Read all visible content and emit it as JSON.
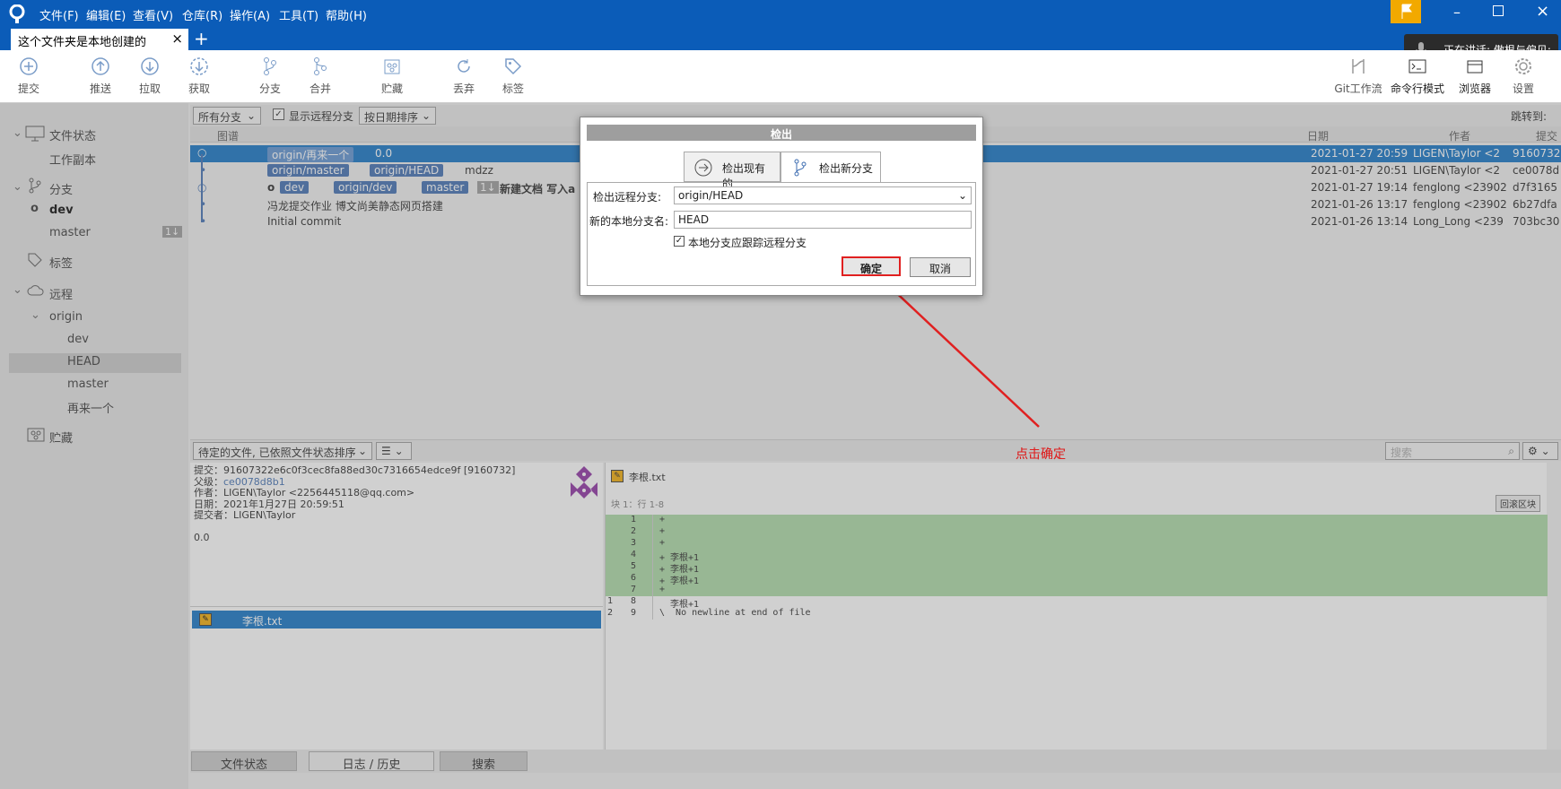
{
  "app": {
    "menus": [
      "文件(F)",
      "编辑(E)",
      "查看(V)",
      "仓库(R)",
      "操作(A)",
      "工具(T)",
      "帮助(H)"
    ],
    "tab_title": "这个文件夹是本地创建的",
    "speaking": "正在讲话: 傲根与偏见;"
  },
  "toolbar": {
    "left": [
      "提交",
      "推送",
      "拉取",
      "获取",
      "分支",
      "合并",
      "贮藏",
      "丢弃",
      "标签"
    ],
    "right": [
      "Git工作流",
      "命令行模式",
      "浏览器",
      "设置"
    ]
  },
  "sidebar": {
    "file_status": "文件状态",
    "working_copy": "工作副本",
    "branches": "分支",
    "branch_items": [
      "dev",
      "master"
    ],
    "master_badge": "1↓",
    "tags": "标签",
    "remotes": "远程",
    "origin": "origin",
    "remote_items": [
      "dev",
      "HEAD",
      "master",
      "再来一个"
    ],
    "stashes": "贮藏"
  },
  "filter": {
    "branch_select": "所有分支",
    "show_remote": "显示远程分支",
    "sort": "按日期排序",
    "jump": "跳转到:"
  },
  "columns": {
    "graph": "图谱",
    "date": "日期",
    "author": "作者",
    "commit": "提交"
  },
  "commits": [
    {
      "tags": [
        "origin/再来一个"
      ],
      "msg": "0.0",
      "date": "2021-01-27 20:59",
      "author": "LIGEN\\Taylor <2",
      "hash": "9160732"
    },
    {
      "tags": [
        "origin/master",
        "origin/HEAD"
      ],
      "msg": "mdzz",
      "date": "2021-01-27 20:51",
      "author": "LIGEN\\Taylor <2",
      "hash": "ce0078d"
    },
    {
      "tags": [
        "dev",
        "origin/dev",
        "master"
      ],
      "badge": "1↓",
      "msg": "新建文档  写入a",
      "date": "2021-01-27 19:14",
      "author": "fenglong <23902",
      "hash": "d7f3165"
    },
    {
      "tags": [],
      "msg": "冯龙提交作业  博文尚美静态网页搭建",
      "date": "2021-01-26 13:17",
      "author": "fenglong <23902",
      "hash": "6b27dfa"
    },
    {
      "tags": [],
      "msg": "Initial commit",
      "date": "2021-01-26 13:14",
      "author": "Long_Long <239",
      "hash": "703bc30"
    }
  ],
  "lower": {
    "sort_select": "待定的文件, 已依照文件状态排序",
    "search_placeholder": "搜索",
    "annotation": "点击确定"
  },
  "details": {
    "commit": "提交：91607322e6c0f3cec8fa88ed30c7316654edce9f [9160732]",
    "parent_label": "父级：",
    "parent": "ce0078d8b1",
    "author": "作者：LIGEN\\Taylor <2256445118@qq.com>",
    "date": "日期：2021年1月27日 20:59:51",
    "committer": "提交者：LIGEN\\Taylor",
    "message": "0.0"
  },
  "file": {
    "name": "李根.txt"
  },
  "diff": {
    "file": "李根.txt",
    "hunk": "块 1：行 1-8",
    "rollback": "回滚区块",
    "lines": [
      {
        "o": "",
        "n": "1",
        "t": "+"
      },
      {
        "o": "",
        "n": "2",
        "t": "+"
      },
      {
        "o": "",
        "n": "3",
        "t": "+"
      },
      {
        "o": "",
        "n": "4",
        "t": "+ 李根+1"
      },
      {
        "o": "",
        "n": "5",
        "t": "+ 李根+1"
      },
      {
        "o": "",
        "n": "6",
        "t": "+ 李根+1"
      },
      {
        "o": "",
        "n": "7",
        "t": "+"
      },
      {
        "o": "1",
        "n": "8",
        "t": "  李根+1"
      },
      {
        "o": "2",
        "n": "9",
        "t": "\\  No newline at end of file"
      }
    ]
  },
  "bottom_tabs": [
    "文件状态",
    "日志 / 历史",
    "搜索"
  ],
  "dialog": {
    "title": "检出",
    "tab_existing": "检出现有的",
    "tab_new": "检出新分支",
    "remote_label": "检出远程分支:",
    "remote_value": "origin/HEAD",
    "local_label": "新的本地分支名:",
    "local_value": "HEAD",
    "track": "本地分支应跟踪远程分支",
    "ok": "确定",
    "cancel": "取消"
  }
}
